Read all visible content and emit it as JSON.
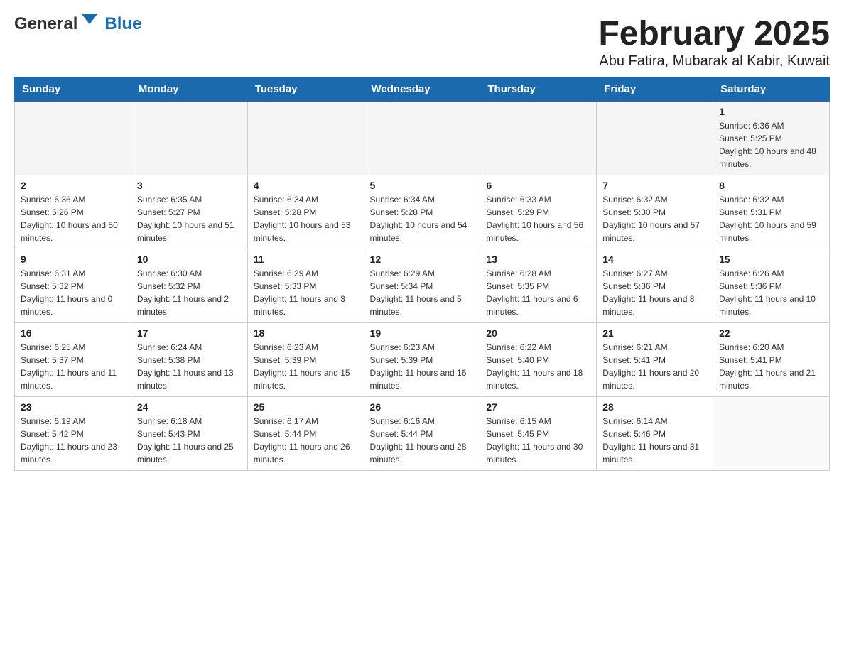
{
  "header": {
    "logo_general": "General",
    "logo_blue": "Blue",
    "title": "February 2025",
    "subtitle": "Abu Fatira, Mubarak al Kabir, Kuwait"
  },
  "days_of_week": [
    "Sunday",
    "Monday",
    "Tuesday",
    "Wednesday",
    "Thursday",
    "Friday",
    "Saturday"
  ],
  "weeks": [
    [
      {
        "day": "",
        "sunrise": "",
        "sunset": "",
        "daylight": ""
      },
      {
        "day": "",
        "sunrise": "",
        "sunset": "",
        "daylight": ""
      },
      {
        "day": "",
        "sunrise": "",
        "sunset": "",
        "daylight": ""
      },
      {
        "day": "",
        "sunrise": "",
        "sunset": "",
        "daylight": ""
      },
      {
        "day": "",
        "sunrise": "",
        "sunset": "",
        "daylight": ""
      },
      {
        "day": "",
        "sunrise": "",
        "sunset": "",
        "daylight": ""
      },
      {
        "day": "1",
        "sunrise": "Sunrise: 6:36 AM",
        "sunset": "Sunset: 5:25 PM",
        "daylight": "Daylight: 10 hours and 48 minutes."
      }
    ],
    [
      {
        "day": "2",
        "sunrise": "Sunrise: 6:36 AM",
        "sunset": "Sunset: 5:26 PM",
        "daylight": "Daylight: 10 hours and 50 minutes."
      },
      {
        "day": "3",
        "sunrise": "Sunrise: 6:35 AM",
        "sunset": "Sunset: 5:27 PM",
        "daylight": "Daylight: 10 hours and 51 minutes."
      },
      {
        "day": "4",
        "sunrise": "Sunrise: 6:34 AM",
        "sunset": "Sunset: 5:28 PM",
        "daylight": "Daylight: 10 hours and 53 minutes."
      },
      {
        "day": "5",
        "sunrise": "Sunrise: 6:34 AM",
        "sunset": "Sunset: 5:28 PM",
        "daylight": "Daylight: 10 hours and 54 minutes."
      },
      {
        "day": "6",
        "sunrise": "Sunrise: 6:33 AM",
        "sunset": "Sunset: 5:29 PM",
        "daylight": "Daylight: 10 hours and 56 minutes."
      },
      {
        "day": "7",
        "sunrise": "Sunrise: 6:32 AM",
        "sunset": "Sunset: 5:30 PM",
        "daylight": "Daylight: 10 hours and 57 minutes."
      },
      {
        "day": "8",
        "sunrise": "Sunrise: 6:32 AM",
        "sunset": "Sunset: 5:31 PM",
        "daylight": "Daylight: 10 hours and 59 minutes."
      }
    ],
    [
      {
        "day": "9",
        "sunrise": "Sunrise: 6:31 AM",
        "sunset": "Sunset: 5:32 PM",
        "daylight": "Daylight: 11 hours and 0 minutes."
      },
      {
        "day": "10",
        "sunrise": "Sunrise: 6:30 AM",
        "sunset": "Sunset: 5:32 PM",
        "daylight": "Daylight: 11 hours and 2 minutes."
      },
      {
        "day": "11",
        "sunrise": "Sunrise: 6:29 AM",
        "sunset": "Sunset: 5:33 PM",
        "daylight": "Daylight: 11 hours and 3 minutes."
      },
      {
        "day": "12",
        "sunrise": "Sunrise: 6:29 AM",
        "sunset": "Sunset: 5:34 PM",
        "daylight": "Daylight: 11 hours and 5 minutes."
      },
      {
        "day": "13",
        "sunrise": "Sunrise: 6:28 AM",
        "sunset": "Sunset: 5:35 PM",
        "daylight": "Daylight: 11 hours and 6 minutes."
      },
      {
        "day": "14",
        "sunrise": "Sunrise: 6:27 AM",
        "sunset": "Sunset: 5:36 PM",
        "daylight": "Daylight: 11 hours and 8 minutes."
      },
      {
        "day": "15",
        "sunrise": "Sunrise: 6:26 AM",
        "sunset": "Sunset: 5:36 PM",
        "daylight": "Daylight: 11 hours and 10 minutes."
      }
    ],
    [
      {
        "day": "16",
        "sunrise": "Sunrise: 6:25 AM",
        "sunset": "Sunset: 5:37 PM",
        "daylight": "Daylight: 11 hours and 11 minutes."
      },
      {
        "day": "17",
        "sunrise": "Sunrise: 6:24 AM",
        "sunset": "Sunset: 5:38 PM",
        "daylight": "Daylight: 11 hours and 13 minutes."
      },
      {
        "day": "18",
        "sunrise": "Sunrise: 6:23 AM",
        "sunset": "Sunset: 5:39 PM",
        "daylight": "Daylight: 11 hours and 15 minutes."
      },
      {
        "day": "19",
        "sunrise": "Sunrise: 6:23 AM",
        "sunset": "Sunset: 5:39 PM",
        "daylight": "Daylight: 11 hours and 16 minutes."
      },
      {
        "day": "20",
        "sunrise": "Sunrise: 6:22 AM",
        "sunset": "Sunset: 5:40 PM",
        "daylight": "Daylight: 11 hours and 18 minutes."
      },
      {
        "day": "21",
        "sunrise": "Sunrise: 6:21 AM",
        "sunset": "Sunset: 5:41 PM",
        "daylight": "Daylight: 11 hours and 20 minutes."
      },
      {
        "day": "22",
        "sunrise": "Sunrise: 6:20 AM",
        "sunset": "Sunset: 5:41 PM",
        "daylight": "Daylight: 11 hours and 21 minutes."
      }
    ],
    [
      {
        "day": "23",
        "sunrise": "Sunrise: 6:19 AM",
        "sunset": "Sunset: 5:42 PM",
        "daylight": "Daylight: 11 hours and 23 minutes."
      },
      {
        "day": "24",
        "sunrise": "Sunrise: 6:18 AM",
        "sunset": "Sunset: 5:43 PM",
        "daylight": "Daylight: 11 hours and 25 minutes."
      },
      {
        "day": "25",
        "sunrise": "Sunrise: 6:17 AM",
        "sunset": "Sunset: 5:44 PM",
        "daylight": "Daylight: 11 hours and 26 minutes."
      },
      {
        "day": "26",
        "sunrise": "Sunrise: 6:16 AM",
        "sunset": "Sunset: 5:44 PM",
        "daylight": "Daylight: 11 hours and 28 minutes."
      },
      {
        "day": "27",
        "sunrise": "Sunrise: 6:15 AM",
        "sunset": "Sunset: 5:45 PM",
        "daylight": "Daylight: 11 hours and 30 minutes."
      },
      {
        "day": "28",
        "sunrise": "Sunrise: 6:14 AM",
        "sunset": "Sunset: 5:46 PM",
        "daylight": "Daylight: 11 hours and 31 minutes."
      },
      {
        "day": "",
        "sunrise": "",
        "sunset": "",
        "daylight": ""
      }
    ]
  ]
}
